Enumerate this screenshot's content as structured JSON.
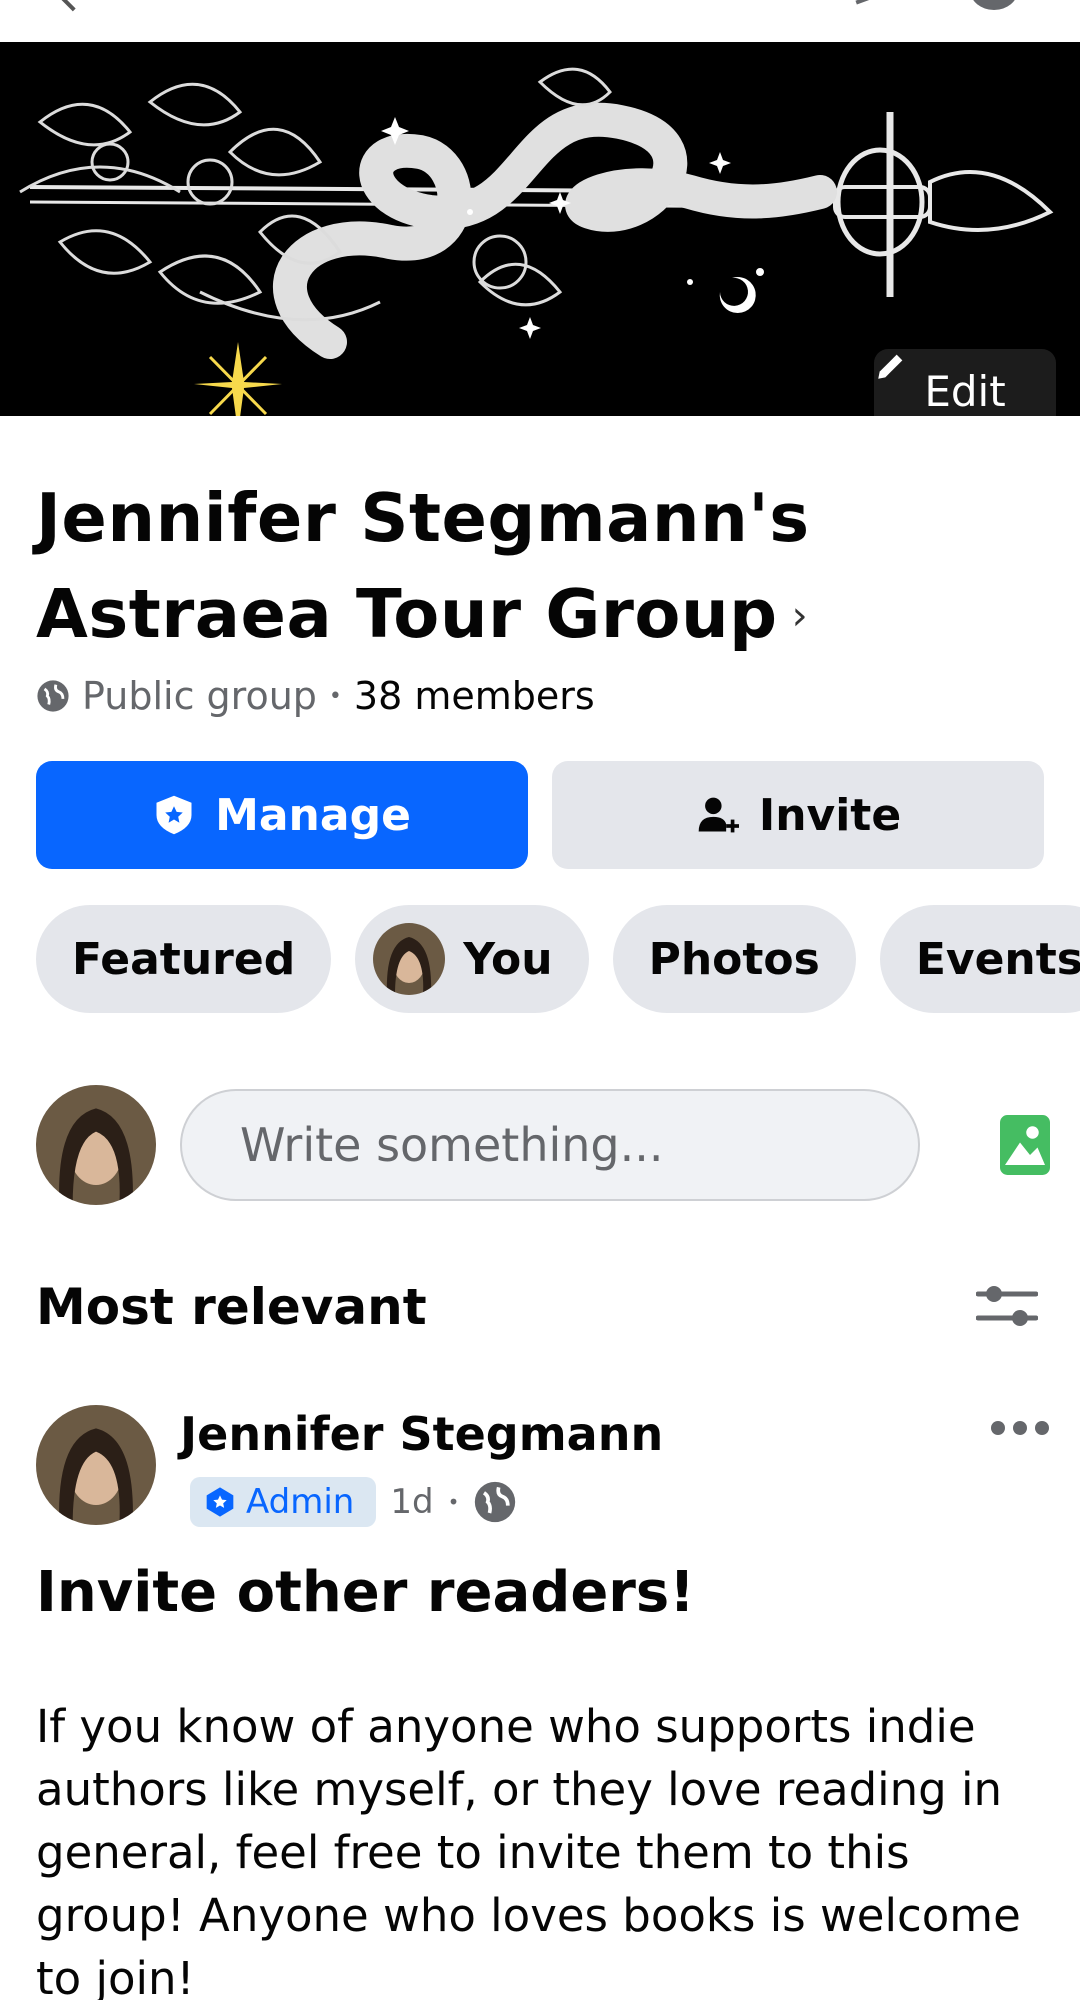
{
  "cover": {
    "edit_label": "Edit"
  },
  "group": {
    "title": "Jennifer Stegmann's Astraea Tour Group",
    "chevron": "›",
    "privacy": "Public group",
    "separator": "•",
    "members": "38 members"
  },
  "actions": {
    "manage_label": "Manage",
    "invite_label": "Invite"
  },
  "tabs": [
    {
      "label": "Featured"
    },
    {
      "label": "You"
    },
    {
      "label": "Photos"
    },
    {
      "label": "Events"
    }
  ],
  "composer": {
    "placeholder": "Write something..."
  },
  "feed": {
    "sort_label": "Most relevant"
  },
  "post": {
    "author": "Jennifer Stegmann",
    "badge": "Admin",
    "time": "1d",
    "separator": "•",
    "title": "Invite other readers!",
    "body": "If you know of anyone who supports indie authors like myself, or they love reading in general, feel free to invite them to this group! Anyone who loves books is welcome to join!"
  },
  "colors": {
    "primary": "#0866ff",
    "secondary_button": "#e4e6eb",
    "muted_text": "#65676b",
    "photo_icon": "#45bd62",
    "cover_bg": "#000000",
    "star": "#f7d94c"
  },
  "icons": [
    "back-arrow-icon",
    "pencil-icon",
    "chevron-right-icon",
    "globe-icon",
    "shield-star-icon",
    "add-person-icon",
    "photo-icon",
    "filter-sliders-icon",
    "more-dots-icon"
  ]
}
